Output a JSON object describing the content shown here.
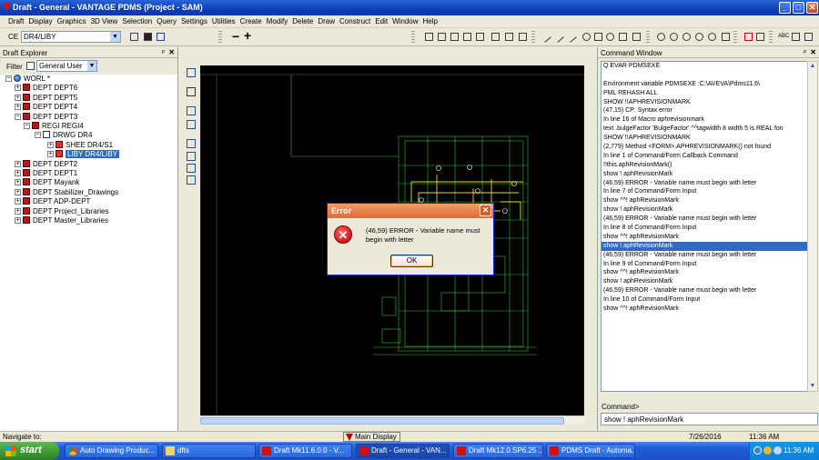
{
  "window": {
    "title": "Draft - General - VANTAGE PDMS (Project - SAM)",
    "minimize": "_",
    "maximize": "□",
    "close": "✕"
  },
  "menu": [
    "Draft",
    "Display",
    "Graphics",
    "3D View",
    "Selection",
    "Query",
    "Settings",
    "Utilities",
    "Create",
    "Modify",
    "Delete",
    "Draw",
    "Construct",
    "Edit",
    "Window",
    "Help"
  ],
  "toolbar": {
    "ce_label": "CE",
    "ce_value": "DR4/LIBY",
    "minus": "−",
    "plus": "+",
    "text_tool": "ABC"
  },
  "explorer": {
    "title": "Draft Explorer",
    "pin": "ᵖ",
    "close": "✕",
    "filter_label": "Filter",
    "filter_value": "General User",
    "tree": [
      {
        "label": "WORL *",
        "icon": "globe",
        "expander": "−"
      },
      {
        "label": "DEPT DEPT6",
        "icon": "dept",
        "expander": "+"
      },
      {
        "label": "DEPT DEPT5",
        "icon": "dept",
        "expander": "+"
      },
      {
        "label": "DEPT DEPT4",
        "icon": "dept",
        "expander": "+"
      },
      {
        "label": "DEPT DEPT3",
        "icon": "dept",
        "expander": "−"
      },
      {
        "label": "REGI REGI4",
        "icon": "dept",
        "expander": "−"
      },
      {
        "label": "DRWG DR4",
        "icon": "drwg",
        "expander": "−"
      },
      {
        "label": "SHEE DR4/S1",
        "icon": "sheet",
        "expander": "+"
      },
      {
        "label": "LIBY DR4/LIBY",
        "icon": "sheet",
        "expander": "+",
        "selected": true
      },
      {
        "label": "DEPT DEPT2",
        "icon": "dept",
        "expander": "+"
      },
      {
        "label": "DEPT DEPT1",
        "icon": "dept",
        "expander": "+"
      },
      {
        "label": "DEPT Mayank",
        "icon": "dept",
        "expander": "+"
      },
      {
        "label": "DEPT Stabilizer_Drawings",
        "icon": "dept",
        "expander": "+"
      },
      {
        "label": "DEPT ADP-DEPT",
        "icon": "dept",
        "expander": "+"
      },
      {
        "label": "DEPT Project_Libraries",
        "icon": "dept",
        "expander": "+"
      },
      {
        "label": "DEPT Master_Libraries",
        "icon": "dept",
        "expander": "+"
      }
    ]
  },
  "dialog": {
    "title": "Error",
    "close": "✕",
    "icon": "error-icon",
    "icon_glyph": "✕",
    "message": "(46,59) ERROR - Variable name must begin with letter",
    "ok_label": "OK"
  },
  "command_window": {
    "title": "Command Window",
    "pin": "ᵖ",
    "close": "✕",
    "lines": [
      "Q EVAR PDMSEXE",
      "",
      "Environment variable PDMSEXE :C:\\AVEVA\\Pdms11.6\\",
      "PML REHASH ALL",
      "SHOW !!APHREVISIONMARK",
      "(47,15)   CP: Syntax error",
      "  In line 16 of Macro aphrevisionmark",
      "       text .bulgeFactor 'BulgeFactor' ^^tagwidth 8 width 5 is  REAL fon",
      "SHOW !!APHREVISIONMARK",
      "(2,779)    Method <FORM>.APHREVISIONMARK() not found",
      "  In line 1 of Command/Form Callback Command",
      "!!this.aphRevisionMark()",
      "show ! aphRevisionMark",
      "(46,59)    ERROR - Variable name must begin with letter",
      "  In line 7 of Command/Form Input",
      "show ^^! aphRevisionMark",
      "show ! aphRevisionMark",
      "(46,59)    ERROR - Variable name must begin with letter",
      "  In line 8 of Command/Form Input",
      "show ^^! aphRevisionMark",
      "show ! aphRevisionMark",
      "(46,59)    ERROR - Variable name must begin with letter",
      "  In line 9 of Command/Form Input",
      "show ^^! aphRevisionMark",
      "show ! aphRevisionMark",
      "(46,59)    ERROR - Variable name must begin with letter",
      "  In line 10 of Command/Form Input",
      "show ^^! aphRevisionMark"
    ],
    "highlighted_index": 20,
    "input_label": "Command>",
    "input_value": "show ! aphRevisionMark"
  },
  "statusbar": {
    "left_text": "Navigate to:",
    "main_display": "Main Display ...",
    "date": "7/26/2016",
    "time": "11:36 AM"
  },
  "taskbar": {
    "start": "start",
    "tasks": [
      {
        "label": "Auto Drawing Produc...",
        "icon": "chrome-icon"
      },
      {
        "label": "dfts",
        "icon": "folder-icon"
      },
      {
        "label": "Draft Mk11.6.0.0 - V...",
        "icon": "pdms-icon"
      },
      {
        "label": "Draft - General - VAN...",
        "icon": "pdms-icon",
        "active": true
      },
      {
        "label": "Draft Mk12.0.SP6.25 ...",
        "icon": "pdms-icon"
      },
      {
        "label": "PDMS Draft - Automa...",
        "icon": "pdms-icon"
      }
    ],
    "clock": "11:36 AM"
  },
  "colors": {
    "titlebar": "#0b3fb8",
    "selection": "#316ac5",
    "canvas_bg": "#000000",
    "drawing_green": "#2fbf3a",
    "drawing_yellow": "#e6e000",
    "error_red": "#c00000"
  }
}
